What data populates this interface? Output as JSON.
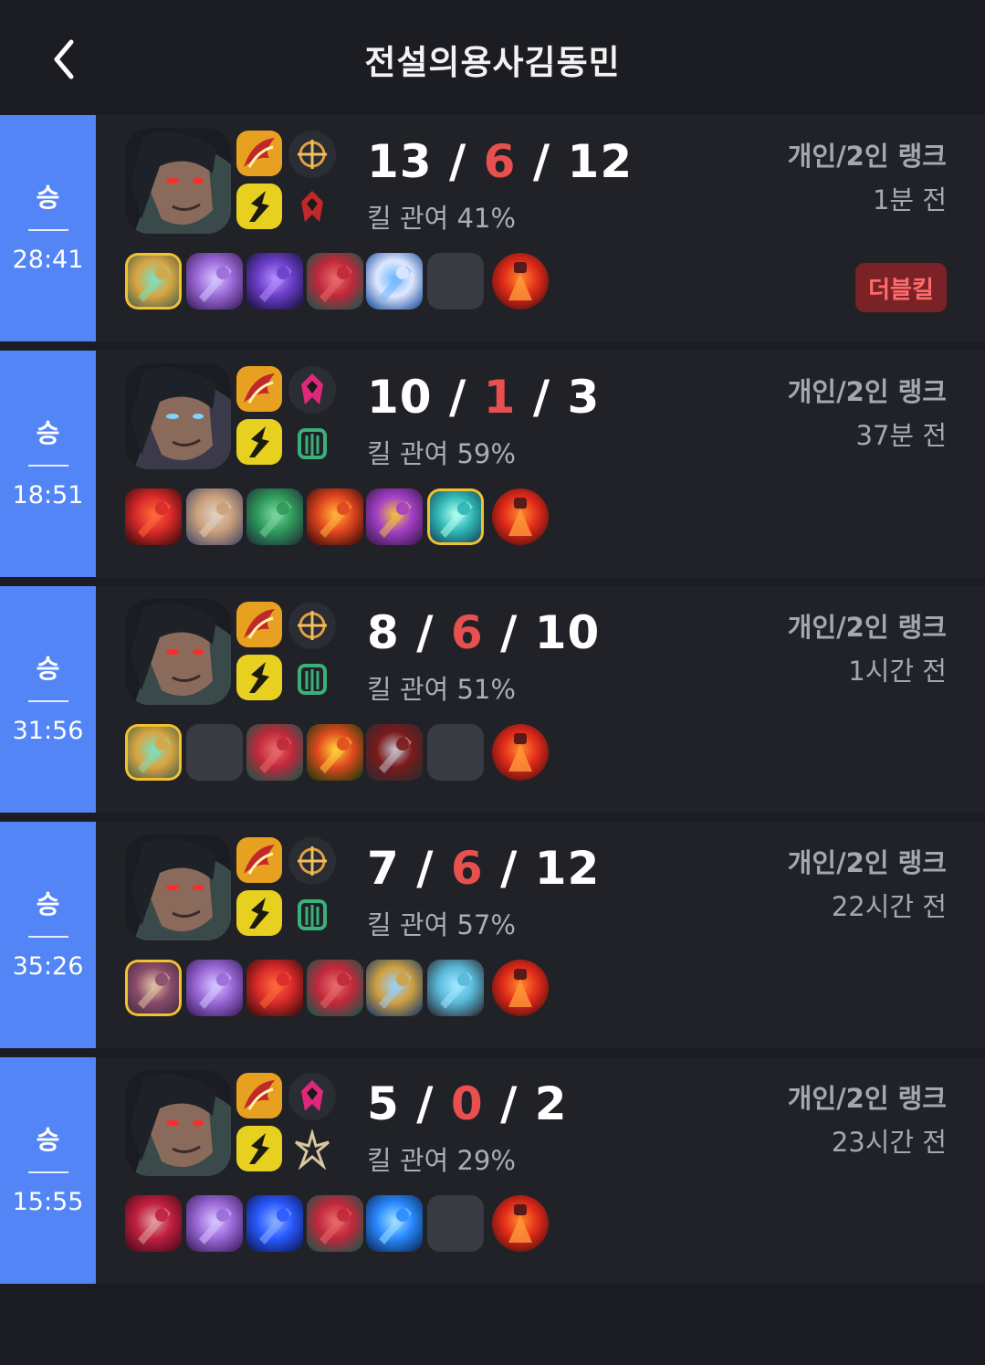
{
  "header": {
    "title": "전설의용사김동민",
    "back_icon": "chevron-left-icon"
  },
  "colors": {
    "win_accent": "#5485f7",
    "death_red": "#e84f4f",
    "item_highlight": "#f3c02e",
    "badge_bg": "#7a2226"
  },
  "matches": [
    {
      "result": "승",
      "duration": "28:41",
      "champion_icon": "champion-portrait-red-eyes",
      "spells": [
        "flame-spell-icon",
        "flash-spell-icon"
      ],
      "runes": [
        "precision-rune-icon",
        "domination-rune-icon"
      ],
      "kills": "13",
      "deaths": "6",
      "assists": "12",
      "kill_participation": "킬 관여 41%",
      "queue": "개인/2인 랭크",
      "time_ago": "1분 전",
      "badge": "더블킬",
      "items": [
        "gold-sword-item",
        "purple-blade-item",
        "shadow-item",
        "red-boots-item",
        "blue-spear-item",
        "empty",
        "red-ward-trinket"
      ],
      "highlighted": [
        0
      ]
    },
    {
      "result": "승",
      "duration": "18:51",
      "champion_icon": "champion-portrait-blue-eyes",
      "spells": [
        "flame-spell-icon",
        "flash-spell-icon"
      ],
      "runes": [
        "domination-rune-icon",
        "resolve-rune-icon"
      ],
      "kills": "10",
      "deaths": "1",
      "assists": "3",
      "kill_participation": "킬 관여 59%",
      "queue": "개인/2인 랭크",
      "time_ago": "37분 전",
      "badge": "",
      "items": [
        "red-mushroom-item",
        "chain-item",
        "green-boots-item",
        "fire-orb-item",
        "purple-wing-item",
        "teal-blade-item",
        "red-ward-trinket"
      ],
      "highlighted": [
        5
      ]
    },
    {
      "result": "승",
      "duration": "31:56",
      "champion_icon": "champion-portrait-red-eyes",
      "spells": [
        "flame-spell-icon",
        "flash-spell-icon"
      ],
      "runes": [
        "precision-rune-icon",
        "resolve-rune-icon"
      ],
      "kills": "8",
      "deaths": "6",
      "assists": "10",
      "kill_participation": "킬 관여 51%",
      "queue": "개인/2인 랭크",
      "time_ago": "1시간 전",
      "badge": "",
      "items": [
        "gold-sword-item",
        "empty",
        "red-boots-item",
        "fire-blade-item",
        "dark-axe-item",
        "empty",
        "red-ward-trinket"
      ],
      "highlighted": [
        0
      ]
    },
    {
      "result": "승",
      "duration": "35:26",
      "champion_icon": "champion-portrait-red-eyes",
      "spells": [
        "flame-spell-icon",
        "flash-spell-icon"
      ],
      "runes": [
        "precision-rune-icon",
        "resolve-rune-icon"
      ],
      "kills": "7",
      "deaths": "6",
      "assists": "12",
      "kill_participation": "킬 관여 57%",
      "queue": "개인/2인 랭크",
      "time_ago": "22시간 전",
      "badge": "",
      "items": [
        "bow-item",
        "purple-blade-item",
        "red-mushroom-item",
        "red-boots-item",
        "spear-item",
        "armor-item",
        "red-ward-trinket"
      ],
      "highlighted": [
        0
      ]
    },
    {
      "result": "승",
      "duration": "15:55",
      "champion_icon": "champion-portrait-red-eyes",
      "spells": [
        "flame-spell-icon",
        "flash-spell-icon"
      ],
      "runes": [
        "domination-rune-icon",
        "inspiration-rune-icon"
      ],
      "kills": "5",
      "deaths": "0",
      "assists": "2",
      "kill_participation": "킬 관여 29%",
      "queue": "개인/2인 랭크",
      "time_ago": "23시간 전",
      "badge": "",
      "items": [
        "red-dagger-item",
        "purple-blade-item",
        "blue-tear-item",
        "red-boots-item",
        "blue-orb-item",
        "empty",
        "red-ward-trinket"
      ],
      "highlighted": []
    }
  ]
}
